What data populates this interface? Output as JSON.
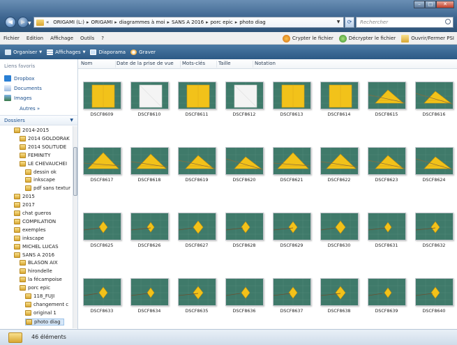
{
  "address": {
    "crumbs": [
      "«",
      "ORIGAMI (L:)",
      "ORIGAMI",
      "diagrammes à moi",
      "SANS A 2016",
      "porc epic",
      "photo diag"
    ],
    "search_placeholder": "Rechercher"
  },
  "menu": {
    "items": [
      "Fichier",
      "Edition",
      "Affichage",
      "Outils",
      "?"
    ],
    "actions": [
      "Crypter le fichier",
      "Décrypter le fichier",
      "Ouvrir/Fermer PSI"
    ]
  },
  "toolbar": {
    "organize": "Organiser",
    "views": "Affichages",
    "slideshow": "Diaporama",
    "burn": "Graver"
  },
  "sidebar": {
    "favorites_header": "Liens favoris",
    "favorites": [
      "Dropbox",
      "Documents",
      "Images"
    ],
    "more": "Autres »",
    "folders_header": "Dossiers",
    "tree": [
      {
        "label": "2014-2015",
        "level": 1
      },
      {
        "label": "2014 GOLDORAK",
        "level": 2
      },
      {
        "label": "2014 SOLITUDE",
        "level": 2
      },
      {
        "label": "FEMINITY",
        "level": 2
      },
      {
        "label": "LE CHEVAUCHEI",
        "level": 2
      },
      {
        "label": "dessin ok",
        "level": 3
      },
      {
        "label": "inkscape",
        "level": 3
      },
      {
        "label": "pdf sans textur",
        "level": 3
      },
      {
        "label": "2015",
        "level": 1
      },
      {
        "label": "2017",
        "level": 1
      },
      {
        "label": "chat gueros",
        "level": 1
      },
      {
        "label": "COMPILATION",
        "level": 1
      },
      {
        "label": "exemples",
        "level": 1
      },
      {
        "label": "inkscape",
        "level": 1
      },
      {
        "label": "MICHEL LUCAS",
        "level": 1
      },
      {
        "label": "SANS A 2016",
        "level": 1
      },
      {
        "label": "BLASON AIX",
        "level": 2
      },
      {
        "label": "hirondelle",
        "level": 2
      },
      {
        "label": "la fécampoise",
        "level": 2
      },
      {
        "label": "porc epic",
        "level": 2
      },
      {
        "label": "118_FUJI",
        "level": 3
      },
      {
        "label": "changement c",
        "level": 3
      },
      {
        "label": "original 1",
        "level": 3
      },
      {
        "label": "photo diag",
        "level": 3,
        "selected": true
      }
    ]
  },
  "columns": [
    "Nom",
    "Date de la prise de vue",
    "Mots-clés",
    "Taille",
    "Notation"
  ],
  "files": [
    {
      "name": "DSCF8609",
      "kind": "flat-yellow"
    },
    {
      "name": "DSCF8610",
      "kind": "flat-white"
    },
    {
      "name": "DSCF8611",
      "kind": "flat-yellow"
    },
    {
      "name": "DSCF8612",
      "kind": "flat-white"
    },
    {
      "name": "DSCF8613",
      "kind": "flat-yellow"
    },
    {
      "name": "DSCF8614",
      "kind": "flat-yellow"
    },
    {
      "name": "DSCF8615",
      "kind": "triangle"
    },
    {
      "name": "DSCF8616",
      "kind": "triangle"
    },
    {
      "name": "DSCF8617",
      "kind": "triangle"
    },
    {
      "name": "DSCF8618",
      "kind": "triangle"
    },
    {
      "name": "DSCF8619",
      "kind": "triangle"
    },
    {
      "name": "DSCF8620",
      "kind": "triangle"
    },
    {
      "name": "DSCF8621",
      "kind": "triangle"
    },
    {
      "name": "DSCF8622",
      "kind": "triangle"
    },
    {
      "name": "DSCF8623",
      "kind": "triangle"
    },
    {
      "name": "DSCF8624",
      "kind": "triangle"
    },
    {
      "name": "DSCF8625",
      "kind": "small"
    },
    {
      "name": "DSCF8626",
      "kind": "small"
    },
    {
      "name": "DSCF8627",
      "kind": "small"
    },
    {
      "name": "DSCF8628",
      "kind": "small"
    },
    {
      "name": "DSCF8629",
      "kind": "small"
    },
    {
      "name": "DSCF8630",
      "kind": "small"
    },
    {
      "name": "DSCF8631",
      "kind": "small"
    },
    {
      "name": "DSCF8632",
      "kind": "small"
    },
    {
      "name": "DSCF8633",
      "kind": "small"
    },
    {
      "name": "DSCF8634",
      "kind": "small"
    },
    {
      "name": "DSCF8635",
      "kind": "small"
    },
    {
      "name": "DSCF8636",
      "kind": "small"
    },
    {
      "name": "DSCF8637",
      "kind": "small"
    },
    {
      "name": "DSCF8638",
      "kind": "small"
    },
    {
      "name": "DSCF8639",
      "kind": "small"
    },
    {
      "name": "DSCF8640",
      "kind": "small"
    }
  ],
  "status": {
    "count": "46 éléments"
  },
  "colors": {
    "accent": "#2d5a86",
    "paper": "#f2c21a",
    "mat": "#3f7a6a"
  }
}
